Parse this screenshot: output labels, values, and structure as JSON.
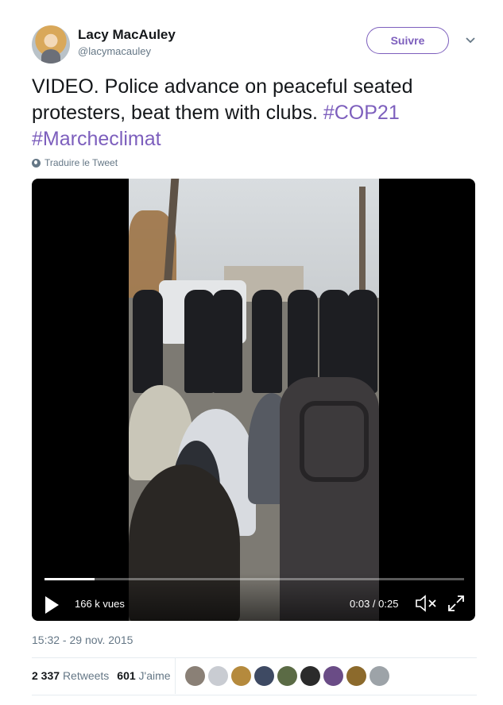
{
  "author": {
    "name": "Lacy MacAuley",
    "handle": "@lacymacauley",
    "avatar_icon": "user-avatar"
  },
  "follow_button": "Suivre",
  "tweet": {
    "text": "VIDEO. Police advance on peaceful seated protesters, beat them with clubs. ",
    "hashtag1": "#COP21",
    "hashtag2": "#Marcheclimat"
  },
  "translate_label": "Traduire le Tweet",
  "video": {
    "views": "166 k vues",
    "time": "0:03 / 0:25",
    "progress": 0.12
  },
  "timestamp": "15:32 - 29 nov. 2015",
  "stats": {
    "retweets_count": "2 337",
    "retweets_label": "Retweets",
    "likes_count": "601",
    "likes_label": "J'aime"
  },
  "likers": [
    "#8a8076",
    "#c9ccd2",
    "#b58a3d",
    "#3e4a63",
    "#5b6b45",
    "#2b2b2b",
    "#6a4c86",
    "#8c6a2c",
    "#9da3a8"
  ],
  "colors": {
    "accent": "#7d5fbd",
    "muted": "#657786",
    "text": "#14171a"
  }
}
